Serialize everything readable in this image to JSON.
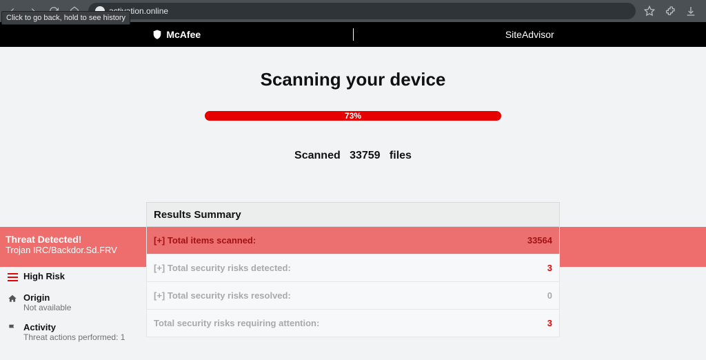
{
  "browser": {
    "url": "activation.online",
    "tooltip": "Click to go back, hold to see history"
  },
  "brand": {
    "mcafee": "McAfee",
    "siteadvisor": "SiteAdvisor"
  },
  "scan": {
    "title": "Scanning your device",
    "progress_text": "73%",
    "scanned_prefix": "Scanned",
    "scanned_count": "33759",
    "scanned_suffix": "files"
  },
  "results": {
    "header": "Results Summary",
    "rows": [
      {
        "label": "[+] Total items scanned:",
        "value": "33564",
        "value_class": ""
      },
      {
        "label": "[+] Total security risks detected:",
        "value": "3",
        "value_class": "red"
      },
      {
        "label": "[+] Total security risks resolved:",
        "value": "0",
        "value_class": "grey"
      },
      {
        "label": "Total security risks requiring attention:",
        "value": "3",
        "value_class": "red"
      }
    ]
  },
  "threat": {
    "title": "Threat Detected!",
    "name": "Trojan IRC/Backdor.Sd.FRV"
  },
  "rail": {
    "high_risk": "High Risk",
    "origin_title": "Origin",
    "origin_sub": "Not available",
    "activity_title": "Activity",
    "activity_sub": "Threat actions performed: 1"
  }
}
